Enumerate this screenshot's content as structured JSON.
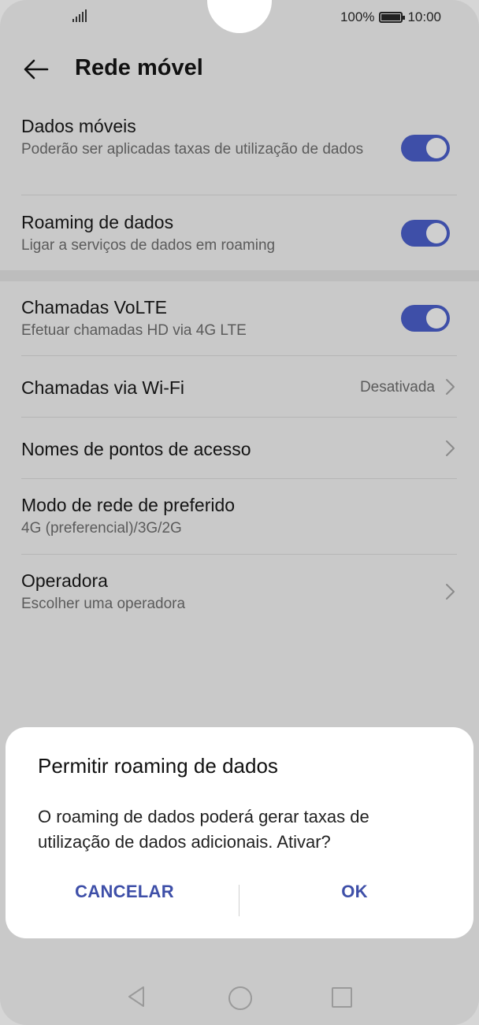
{
  "status_bar": {
    "battery_percent": "100%",
    "time": "10:00"
  },
  "header": {
    "title": "Rede móvel"
  },
  "settings": {
    "mobile_data": {
      "title": "Dados móveis",
      "subtitle": "Poderão ser aplicadas taxas de utilização de dados",
      "enabled": true
    },
    "data_roaming": {
      "title": "Roaming de dados",
      "subtitle": "Ligar a serviços de dados em roaming",
      "enabled": true
    },
    "volte": {
      "title": "Chamadas VoLTE",
      "subtitle": "Efetuar chamadas HD via 4G LTE",
      "enabled": true
    },
    "wifi_calling": {
      "title": "Chamadas via Wi-Fi",
      "value": "Desativada"
    },
    "apn": {
      "title": "Nomes de pontos de acesso"
    },
    "network_mode": {
      "title": "Modo de rede de preferido",
      "subtitle": "4G (preferencial)/3G/2G"
    },
    "operator": {
      "title": "Operadora",
      "subtitle": "Escolher uma operadora"
    }
  },
  "dialog": {
    "title": "Permitir roaming de dados",
    "body": "O roaming de dados poderá gerar taxas de utilização de dados adicionais. Ativar?",
    "cancel_label": "CANCELAR",
    "ok_label": "OK"
  },
  "colors": {
    "accent": "#3e4fa8",
    "scrim_background": "#c9c9c9"
  }
}
